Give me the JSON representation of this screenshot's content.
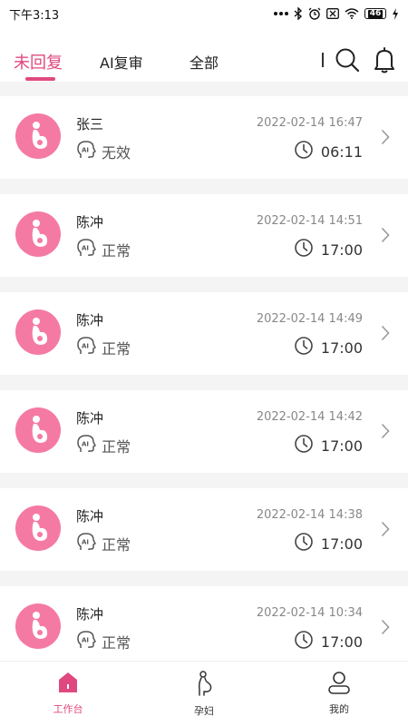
{
  "status_bar": {
    "time": "下午3:13",
    "battery": "46"
  },
  "header": {
    "tabs": [
      {
        "label": "未回复",
        "active": true
      },
      {
        "label": "AI复审",
        "active": false
      },
      {
        "label": "全部",
        "active": false
      }
    ],
    "icons": [
      "search-icon",
      "bell-icon"
    ]
  },
  "records": [
    {
      "name": "张三",
      "date": "2022-02-14 16:47",
      "status": "无效",
      "duration": "06:11"
    },
    {
      "name": "陈冲",
      "date": "2022-02-14 14:51",
      "status": "正常",
      "duration": "17:00"
    },
    {
      "name": "陈冲",
      "date": "2022-02-14 14:49",
      "status": "正常",
      "duration": "17:00"
    },
    {
      "name": "陈冲",
      "date": "2022-02-14 14:42",
      "status": "正常",
      "duration": "17:00"
    },
    {
      "name": "陈冲",
      "date": "2022-02-14 14:38",
      "status": "正常",
      "duration": "17:00"
    },
    {
      "name": "陈冲",
      "date": "2022-02-14 10:34",
      "status": "正常",
      "duration": "17:00"
    }
  ],
  "bottom_nav": {
    "items": [
      {
        "label": "工作台",
        "active": true
      },
      {
        "label": "孕妇",
        "active": false
      },
      {
        "label": "我的",
        "active": false
      }
    ]
  },
  "colors": {
    "accent": "#e0497f",
    "avatar": "#f57aa3",
    "list_bg": "#f4f4f5"
  }
}
